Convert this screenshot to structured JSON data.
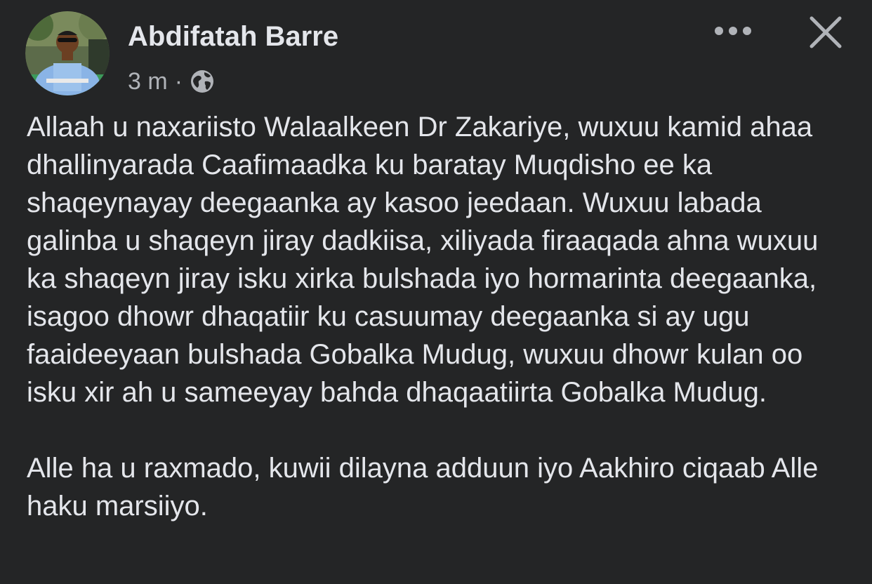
{
  "post": {
    "author": "Abdifatah Barre",
    "time": "3 m",
    "separator": "·",
    "audience_icon": "globe-icon",
    "paragraphs": [
      "Allaah u naxariisto Walaalkeen Dr Zakariye, wuxuu kamid ahaa dhallinyarada Caafimaadka ku baratay Muqdisho ee ka shaqeynayay deegaanka ay kasoo jeedaan. Wuxuu labada galinba u shaqeyn jiray dadkiisa, xiliyada firaaqada ahna wuxuu ka shaqeyn jiray isku xirka bulshada iyo hormarinta deegaanka, isagoo dhowr dhaqatiir ku casuumay deegaanka si ay ugu faaideeyaan bulshada Gobalka Mudug, wuxuu dhowr kulan oo isku xir ah u sameeyay bahda dhaqaatiirta Gobalka Mudug.",
      "Alle ha u raxmado, kuwii dilayna adduun iyo Aakhiro ciqaab Alle haku marsiiyo."
    ]
  },
  "icons": {
    "more": "more-horizontal-icon",
    "close": "close-icon"
  },
  "colors": {
    "background": "#242526",
    "primary_text": "#e4e6eb",
    "secondary_text": "#b0b3b8"
  }
}
